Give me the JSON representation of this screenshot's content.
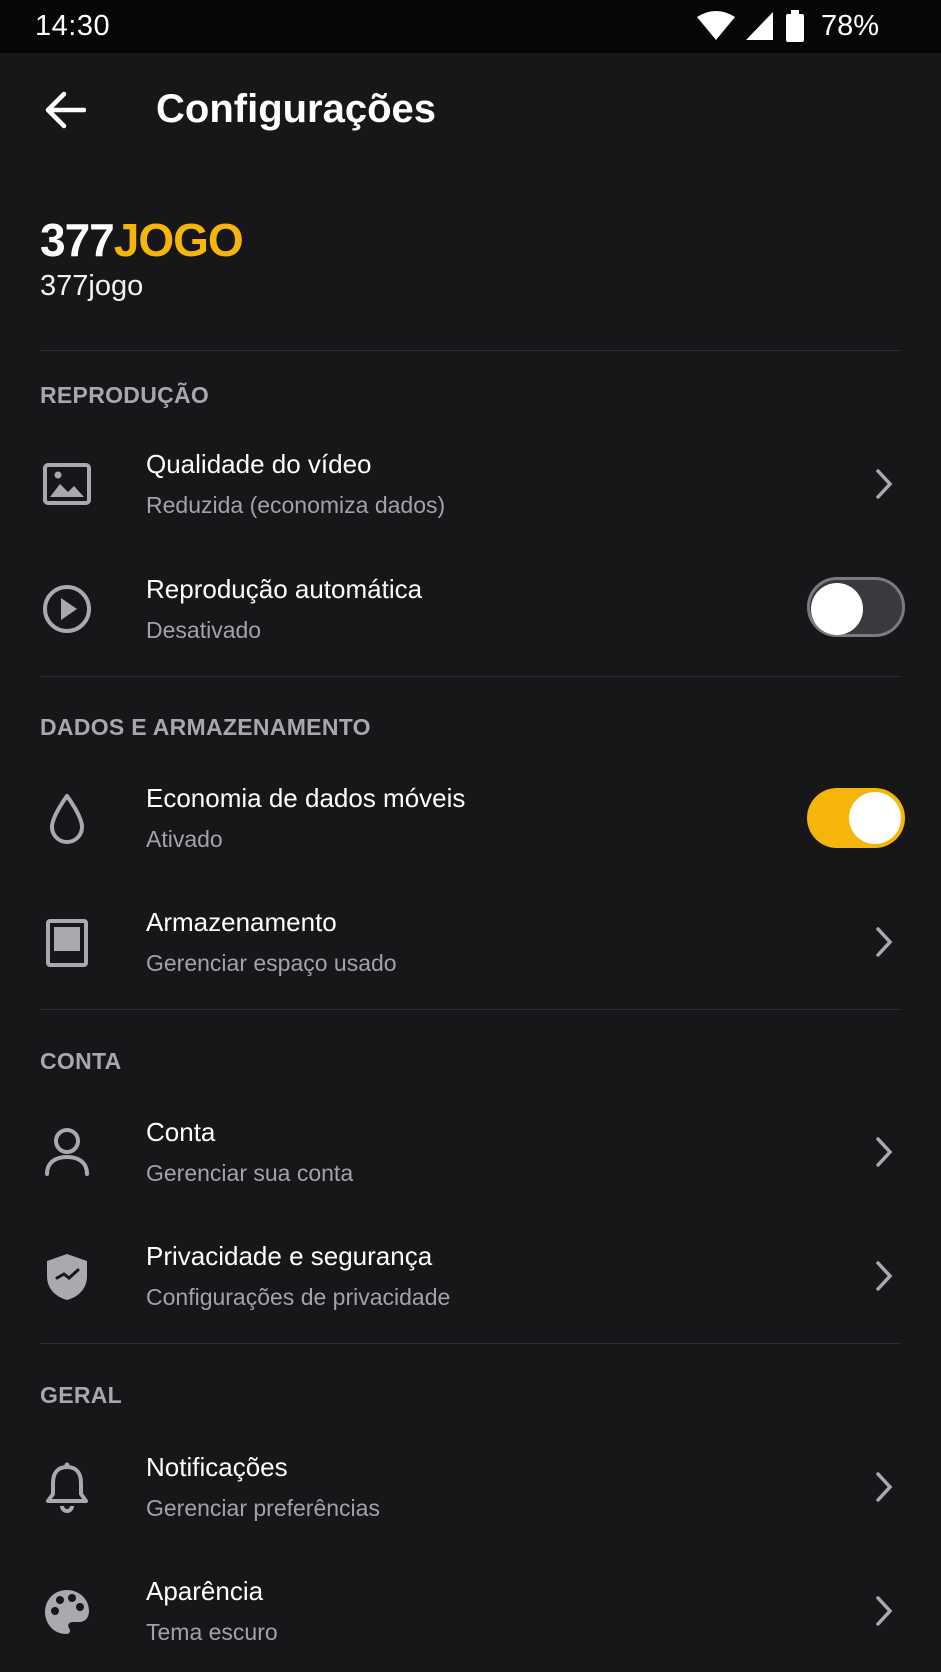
{
  "status_bar": {
    "time": "14:30",
    "battery_percent": "78%",
    "icons": [
      "wifi-icon",
      "signal-icon",
      "battery-icon"
    ]
  },
  "header": {
    "title": "Configurações",
    "back_icon": "arrow-left-icon"
  },
  "brand": {
    "logo_number": "377",
    "logo_word": "JOGO",
    "name": "377jogo",
    "accent_color": "#f5b50a"
  },
  "sections": {
    "playback": {
      "header": "REPRODUÇÃO",
      "video_quality": {
        "title": "Qualidade do vídeo",
        "subtitle": "Reduzida (economiza dados)"
      },
      "autoplay": {
        "title": "Reprodução automática",
        "subtitle": "Desativado",
        "enabled": false
      }
    },
    "data_storage": {
      "header": "DADOS E ARMAZENAMENTO",
      "data_saver": {
        "title": "Economia de dados móveis",
        "subtitle": "Ativado",
        "enabled": true
      },
      "storage": {
        "title": "Armazenamento",
        "subtitle": "Gerenciar espaço usado"
      }
    },
    "account": {
      "header": "CONTA",
      "account": {
        "title": "Conta",
        "subtitle": "Gerenciar sua conta"
      },
      "privacy": {
        "title": "Privacidade e segurança",
        "subtitle": "Configurações de privacidade"
      }
    },
    "general": {
      "header": "GERAL",
      "notifications": {
        "title": "Notificações",
        "subtitle": "Gerenciar preferências"
      },
      "appearance": {
        "title": "Aparência",
        "subtitle": "Tema escuro"
      }
    }
  }
}
